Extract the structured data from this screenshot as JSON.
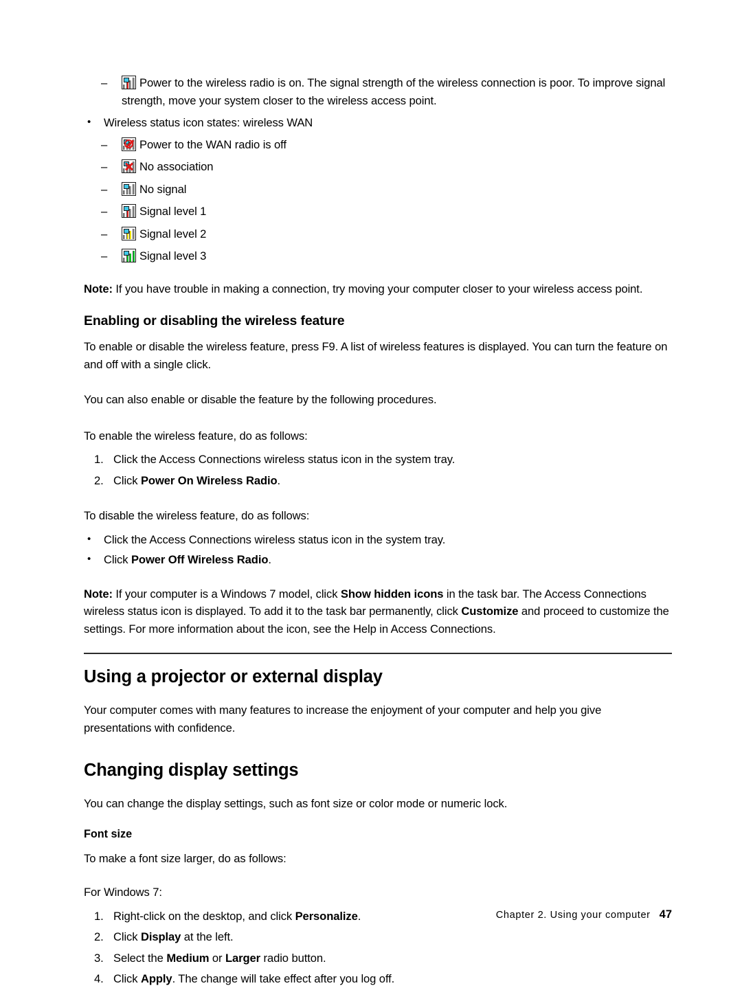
{
  "document": {
    "wlan_poor_signal": {
      "icon": "signal-poor-icon",
      "text": "Power to the wireless radio is on. The signal strength of the wireless connection is poor. To improve signal strength, move your system closer to the wireless access point."
    },
    "wan_bullet": "Wireless status icon states:  wireless WAN",
    "wan_states": [
      {
        "icon": "wan-radio-off-icon",
        "label": "Power to the WAN radio is off"
      },
      {
        "icon": "wan-no-association-icon",
        "label": "No association"
      },
      {
        "icon": "wan-no-signal-icon",
        "label": "No signal"
      },
      {
        "icon": "wan-signal-level-1-icon",
        "label": "Signal level 1"
      },
      {
        "icon": "wan-signal-level-2-icon",
        "label": "Signal level 2"
      },
      {
        "icon": "wan-signal-level-3-icon",
        "label": "Signal level 3"
      }
    ],
    "note_connection": {
      "label": "Note:",
      "text": " If you have trouble in making a connection, try moving your computer closer to your wireless access point."
    },
    "heading_enabling": "Enabling or disabling the wireless feature",
    "para_f9": "To enable or disable the wireless feature, press F9.  A list of wireless features is displayed. You can turn the feature on and off with a single click.",
    "para_also": "You can also enable or disable the feature by the following procedures.",
    "para_to_enable": "To enable the wireless feature, do as follows:",
    "enable_steps": [
      {
        "num": "1.",
        "pre": "Click the Access Connections wireless status icon in the system tray.",
        "bold": "",
        "post": ""
      },
      {
        "num": "2.",
        "pre": "Click ",
        "bold": "Power On Wireless Radio",
        "post": "."
      }
    ],
    "para_to_disable": "To disable the wireless feature, do as follows:",
    "disable_steps": [
      {
        "pre": "Click the Access Connections wireless status icon in the system tray.",
        "bold": "",
        "post": ""
      },
      {
        "pre": "Click ",
        "bold": "Power Off Wireless Radio",
        "post": "."
      }
    ],
    "note_windows7": {
      "label": "Note:",
      "part1": " If your computer is a Windows 7 model, click ",
      "bold1": "Show hidden icons",
      "part2": " in the task bar.  The Access Connections wireless status icon is displayed. To add it to the task bar permanently, click ",
      "bold2": "Customize",
      "part3": " and proceed to customize the settings. For more information about the icon, see the Help in Access Connections."
    },
    "heading_projector": "Using a projector or external display",
    "para_projector": "Your computer comes with many features to increase the enjoyment of your computer and help you give presentations with confidence.",
    "heading_changing_display": "Changing display settings",
    "para_changing_display": "You can change the display settings, such as font size or color mode or numeric lock.",
    "heading_font_size": "Font size",
    "para_font_larger": "To make a font size larger, do as follows:",
    "para_for_windows7": "For Windows 7:",
    "font_steps": [
      {
        "num": "1.",
        "pre": "Right-click on the desktop, and click ",
        "bold": "Personalize",
        "post": "."
      },
      {
        "num": "2.",
        "pre": "Click ",
        "bold": "Display",
        "post": " at the left."
      },
      {
        "num": "3.",
        "pre": "Select the ",
        "bold": "Medium",
        "mid": " or ",
        "bold2": "Larger",
        "post": " radio button."
      },
      {
        "num": "4.",
        "pre": "Click ",
        "bold": "Apply",
        "post": ".  The change will take effect after you log off."
      }
    ]
  },
  "footer": {
    "text": "Chapter 2.  Using your computer",
    "page": "47"
  },
  "colors": {
    "text": "#000000",
    "rule": "#2b2b2b",
    "signal_red": "#e01b1b",
    "signal_yellow": "#f2e500",
    "signal_green": "#00c422",
    "signal_grey": "#808080",
    "laptop_screen": "#41c7e8"
  }
}
